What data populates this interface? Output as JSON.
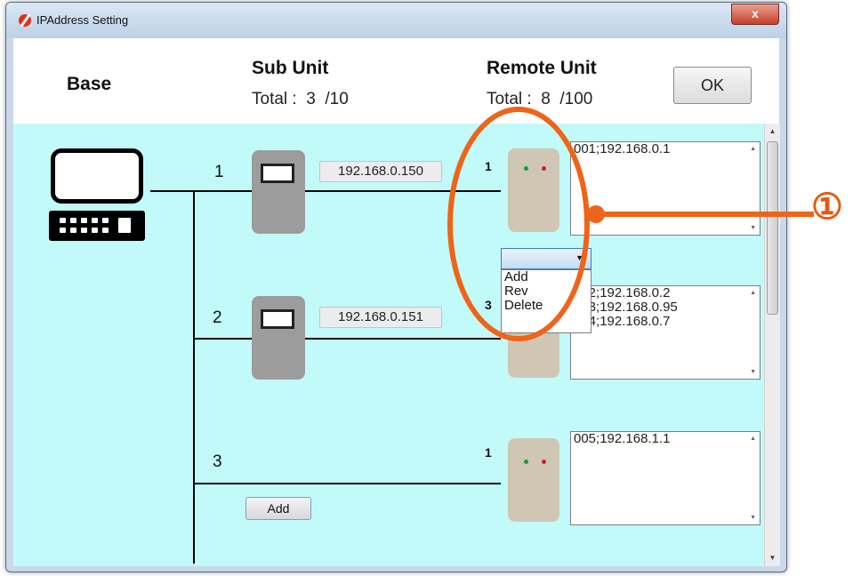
{
  "window": {
    "title": "IPAddress Setting",
    "close_glyph": "x"
  },
  "header": {
    "base_label": "Base",
    "sub_unit_label": "Sub Unit",
    "remote_unit_label": "Remote Unit",
    "sub_total": "Total :  3  /10",
    "remote_total": "Total :  8  /100",
    "ok_label": "OK"
  },
  "units": [
    {
      "number": "1",
      "ip": "192.168.0.150",
      "remote_number": "1",
      "remote_list": [
        "001;192.168.0.1"
      ]
    },
    {
      "number": "2",
      "ip": "192.168.0.151",
      "remote_number": "3",
      "remote_list": [
        "002;192.168.0.2",
        "003;192.168.0.95",
        "004;192.168.0.7"
      ]
    },
    {
      "number": "3",
      "remote_number": "1",
      "remote_list": [
        "005;192.168.1.1"
      ],
      "add_label": "Add"
    }
  ],
  "dropdown": {
    "selected": "",
    "options": [
      "Add",
      "Rev",
      "Delete"
    ]
  },
  "callout": {
    "number": "①",
    "color": "#ee6418"
  },
  "icons": {
    "app": "app-logo-icon",
    "pc": "computer-icon",
    "led_green": "#1a9a3a",
    "led_red": "#d02020"
  }
}
